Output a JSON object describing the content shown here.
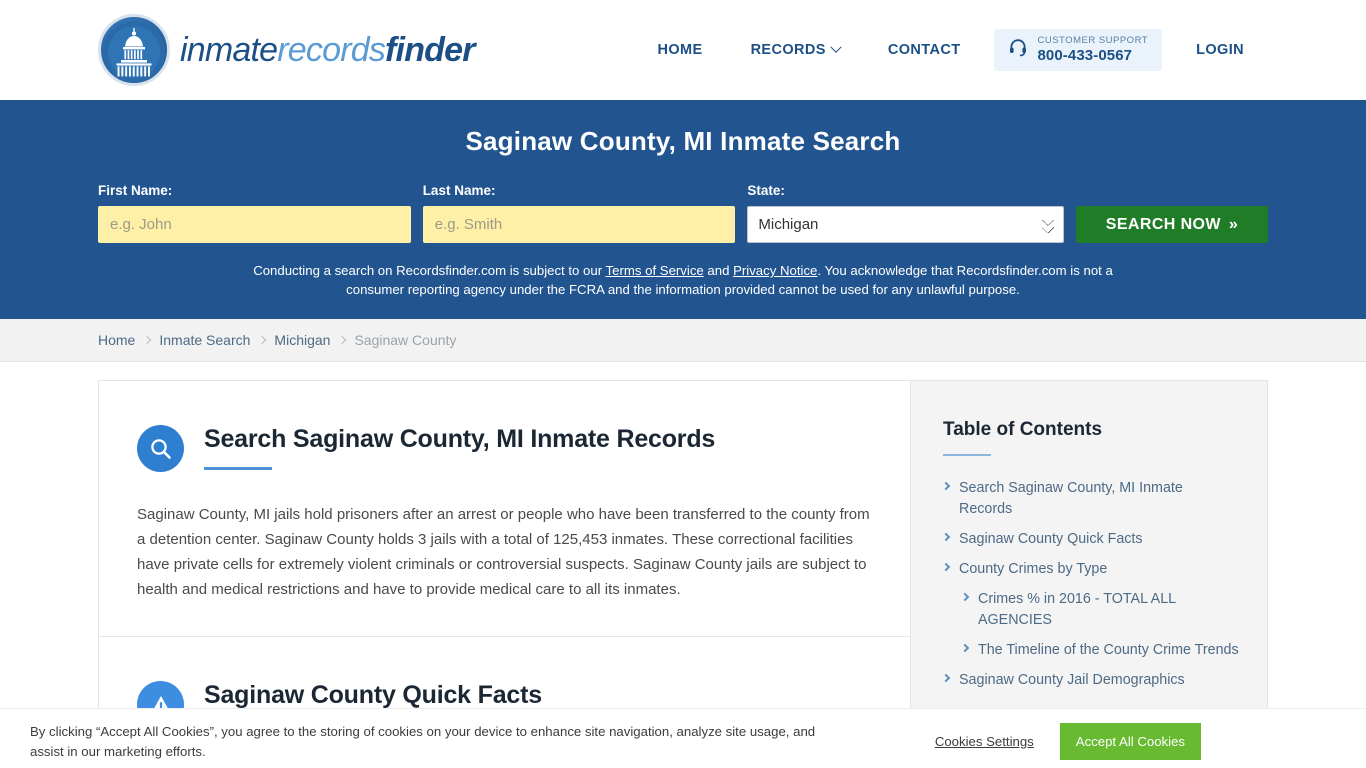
{
  "header": {
    "brand": {
      "part1": "inmate",
      "part2": "records",
      "part3": "finder"
    },
    "nav": [
      {
        "label": "HOME",
        "has_caret": false
      },
      {
        "label": "RECORDS",
        "has_caret": true
      },
      {
        "label": "CONTACT",
        "has_caret": false
      }
    ],
    "support": {
      "title": "CUSTOMER SUPPORT",
      "phone": "800-433-0567"
    },
    "login_label": "LOGIN"
  },
  "hero": {
    "title": "Saginaw County, MI Inmate Search",
    "fields": {
      "first_label": "First Name:",
      "first_placeholder": "e.g. John",
      "first_value": "",
      "last_label": "Last Name:",
      "last_placeholder": "e.g. Smith",
      "last_value": "",
      "state_label": "State:",
      "state_value": "Michigan"
    },
    "search_button": "SEARCH NOW",
    "search_button_arrows": "»",
    "disclaimer": {
      "pre": "Conducting a search on Recordsfinder.com is subject to our ",
      "link1": "Terms of Service",
      "mid": " and ",
      "link2": "Privacy Notice",
      "post": ". You acknowledge that Recordsfinder.com is not a consumer reporting agency under the FCRA and the information provided cannot be used for any unlawful purpose."
    }
  },
  "breadcrumb": [
    {
      "label": "Home",
      "current": false
    },
    {
      "label": "Inmate Search",
      "current": false
    },
    {
      "label": "Michigan",
      "current": false
    },
    {
      "label": "Saginaw County",
      "current": true
    }
  ],
  "main": {
    "sections": [
      {
        "icon": "magnifier-icon",
        "title": "Search Saginaw County, MI Inmate Records",
        "text": "Saginaw County, MI jails hold prisoners after an arrest or people who have been transferred to the county from a detention center. Saginaw County holds 3 jails with a total of 125,453 inmates. These correctional facilities have private cells for extremely violent criminals or controversial suspects. Saginaw County jails are subject to health and medical restrictions and have to provide medical care to all its inmates."
      },
      {
        "icon": "alert-icon",
        "title": "Saginaw County Quick Facts",
        "text": ""
      }
    ]
  },
  "toc": {
    "title": "Table of Contents",
    "items": [
      {
        "label": "Search Saginaw County, MI Inmate Records",
        "sub": false
      },
      {
        "label": "Saginaw County Quick Facts",
        "sub": false
      },
      {
        "label": "County Crimes by Type",
        "sub": false
      },
      {
        "label": "Crimes % in 2016 - TOTAL ALL AGENCIES",
        "sub": true
      },
      {
        "label": "The Timeline of the County Crime Trends",
        "sub": true
      },
      {
        "label": "Saginaw County Jail Demographics",
        "sub": false
      }
    ]
  },
  "cookie": {
    "text": "By clicking “Accept All Cookies”, you agree to the storing of cookies on your device to enhance site navigation, analyze site usage, and assist in our marketing efforts.",
    "settings_label": "Cookies Settings",
    "accept_label": "Accept All Cookies"
  },
  "colors": {
    "hero_blue": "#225590",
    "brand_blue": "#1c4f86",
    "accent_blue": "#4d91d6",
    "input_yellow": "#fff0a8",
    "search_green": "#1f7d28",
    "cookie_green": "#68bb31"
  }
}
